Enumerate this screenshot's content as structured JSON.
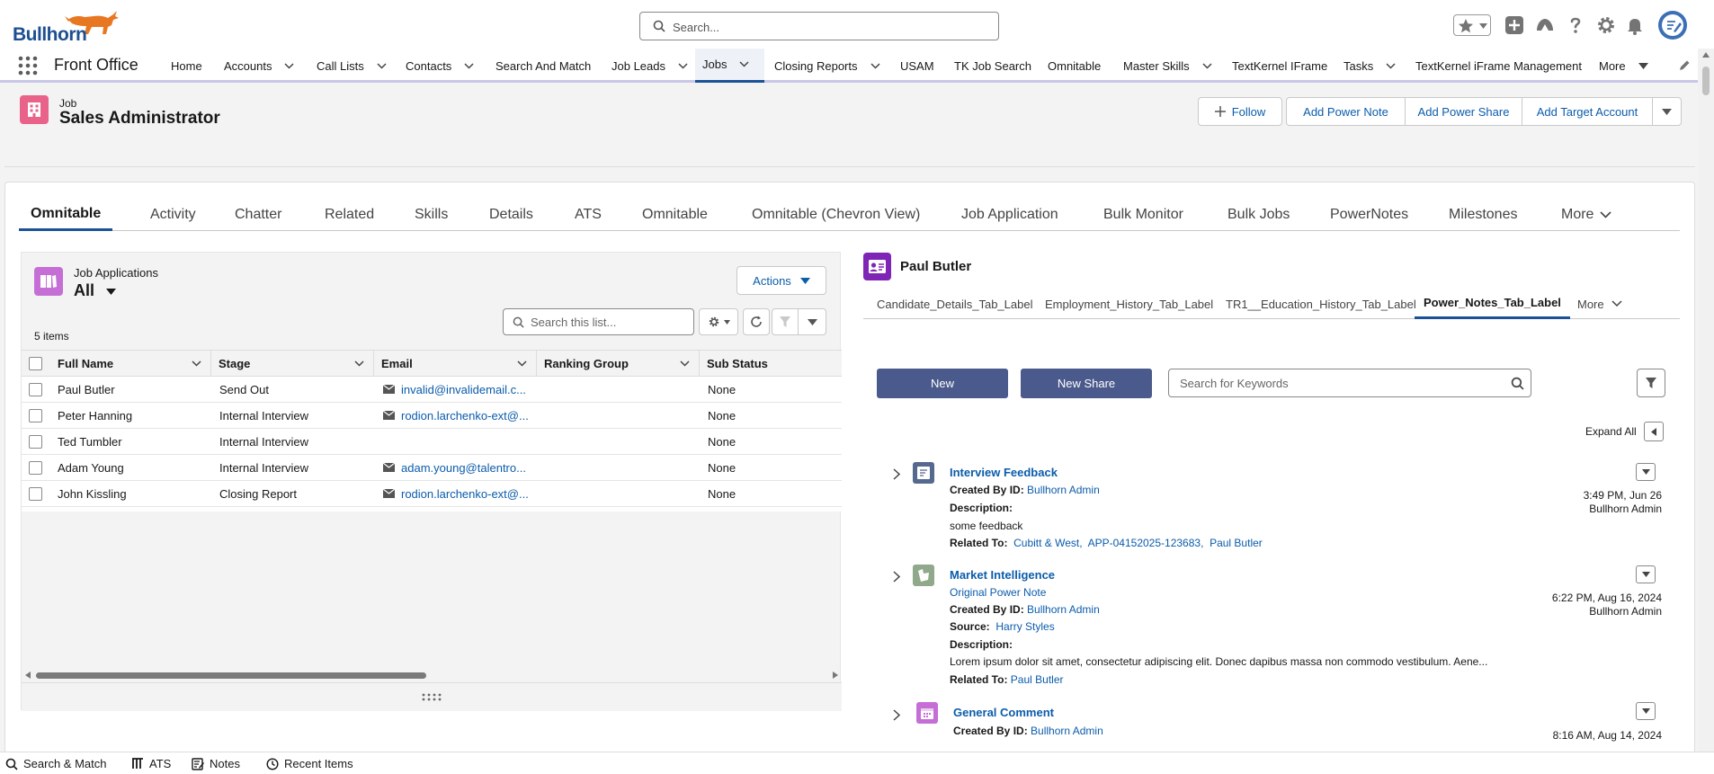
{
  "header": {
    "brand": "Bullhorn",
    "search_placeholder": "Search..."
  },
  "nav": {
    "app_name": "Front Office",
    "items": [
      {
        "label": "Home",
        "menu": false
      },
      {
        "label": "Accounts",
        "menu": true
      },
      {
        "label": "Call Lists",
        "menu": true
      },
      {
        "label": "Contacts",
        "menu": true
      },
      {
        "label": "Search And Match",
        "menu": false
      },
      {
        "label": "Job Leads",
        "menu": true
      },
      {
        "label": "Jobs",
        "menu": true,
        "active": true
      },
      {
        "label": "Closing Reports",
        "menu": true
      },
      {
        "label": "USAM",
        "menu": false
      },
      {
        "label": "TK Job Search",
        "menu": false
      },
      {
        "label": "Omnitable",
        "menu": false
      },
      {
        "label": "Master Skills",
        "menu": true
      },
      {
        "label": "TextKernel IFrame",
        "menu": false
      },
      {
        "label": "Tasks",
        "menu": true
      },
      {
        "label": "TextKernel iFrame Management",
        "menu": false
      },
      {
        "label": "More",
        "menu": true
      }
    ]
  },
  "record": {
    "type": "Job",
    "name": "Sales Administrator",
    "actions": {
      "follow": "Follow",
      "add_power_note": "Add Power Note",
      "add_power_share": "Add Power Share",
      "add_target_account": "Add Target Account"
    }
  },
  "tabs": [
    {
      "label": "Omnitable",
      "active": true
    },
    {
      "label": "Activity"
    },
    {
      "label": "Chatter"
    },
    {
      "label": "Related"
    },
    {
      "label": "Skills"
    },
    {
      "label": "Details"
    },
    {
      "label": "ATS"
    },
    {
      "label": "Omnitable"
    },
    {
      "label": "Omnitable (Chevron View)"
    },
    {
      "label": "Job Application"
    },
    {
      "label": "Bulk Monitor"
    },
    {
      "label": "Bulk Jobs"
    },
    {
      "label": "PowerNotes"
    },
    {
      "label": "Milestones"
    },
    {
      "label": "More"
    }
  ],
  "related_list": {
    "label": "Job Applications",
    "view": "All",
    "count": "5 items",
    "actions_label": "Actions",
    "search_placeholder": "Search this list...",
    "columns": [
      "Full Name",
      "Stage",
      "Email",
      "Ranking Group",
      "Sub Status"
    ],
    "rows": [
      {
        "name": "Paul Butler",
        "stage": "Send Out",
        "email": "invalid@invalidemail.c...",
        "ranking": "",
        "sub_status": "None"
      },
      {
        "name": "Peter Hanning",
        "stage": "Internal Interview",
        "email": "rodion.larchenko-ext@...",
        "ranking": "",
        "sub_status": "None"
      },
      {
        "name": "Ted Tumbler",
        "stage": "Internal Interview",
        "email": "",
        "ranking": "",
        "sub_status": "None"
      },
      {
        "name": "Adam Young",
        "stage": "Internal Interview",
        "email": "adam.young@talentro...",
        "ranking": "",
        "sub_status": "None"
      },
      {
        "name": "John Kissling",
        "stage": "Closing Report",
        "email": "rodion.larchenko-ext@...",
        "ranking": "",
        "sub_status": "None"
      }
    ]
  },
  "candidate_panel": {
    "name": "Paul Butler",
    "tabs": [
      {
        "label": "Candidate_Details_Tab_Label"
      },
      {
        "label": "Employment_History_Tab_Label"
      },
      {
        "label": "TR1__Education_History_Tab_Label"
      },
      {
        "label": "Power_Notes_Tab_Label",
        "active": true
      },
      {
        "label": "More"
      }
    ],
    "new_label": "New",
    "new_share_label": "New Share",
    "search_placeholder": "Search for Keywords",
    "expand_all": "Expand All",
    "notes": [
      {
        "title": "Interview Feedback",
        "created_by_label": "Created By ID:",
        "created_by": "Bullhorn Admin",
        "description_label": "Description:",
        "description": "some feedback",
        "related_label": "Related To:",
        "related": [
          "Cubitt & West,",
          "APP-04152025-123683,",
          "Paul Butler"
        ],
        "time": "3:49 PM, Jun 26",
        "owner": "Bullhorn Admin"
      },
      {
        "title": "Market Intelligence",
        "original": "Original Power Note",
        "created_by_label": "Created By ID:",
        "created_by": "Bullhorn Admin",
        "source_label": "Source:",
        "source": "Harry Styles",
        "description_label": "Description:",
        "description": "Lorem ipsum dolor sit amet, consectetur adipiscing elit. Donec dapibus massa non commodo vestibulum. Aene...",
        "related_label": "Related To:",
        "related": [
          "Paul Butler"
        ],
        "time": "6:22 PM, Aug 16, 2024",
        "owner": "Bullhorn Admin"
      },
      {
        "title": "General Comment",
        "created_by_label": "Created By ID:",
        "created_by": "Bullhorn Admin",
        "time": "8:16 AM, Aug 14, 2024"
      }
    ]
  },
  "utility_bar": [
    {
      "label": "Search & Match"
    },
    {
      "label": "ATS"
    },
    {
      "label": "Notes"
    },
    {
      "label": "Recent Items"
    }
  ],
  "colors": {
    "brand_blue": "#1d4f91",
    "link": "#0b5cab",
    "job_icon": "#e8628a",
    "job_app_icon": "#c56fd6",
    "contact_icon": "#7f25b6",
    "primary_button": "#4b5a8c"
  }
}
